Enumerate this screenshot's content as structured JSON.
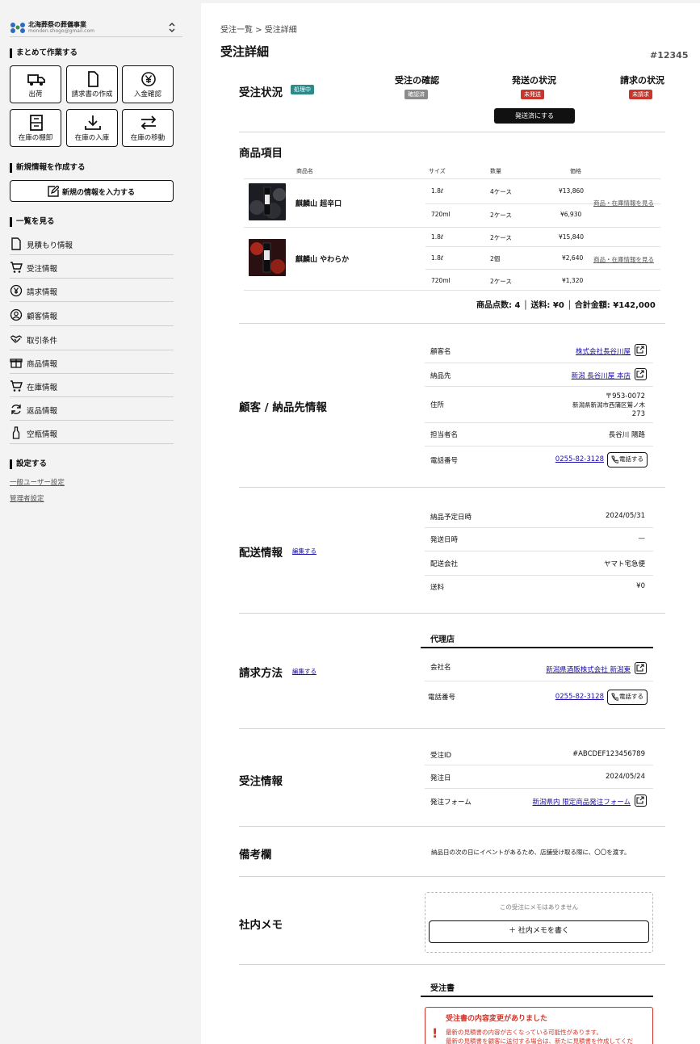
{
  "sidebar": {
    "company": "北海葬祭の葬儀事業",
    "email": "monden.shogo@gmail.com",
    "bulk_title": "まとめて作業する",
    "tiles": [
      "出荷",
      "請求書の作成",
      "入金確認",
      "在庫の棚卸",
      "在庫の入庫",
      "在庫の移動"
    ],
    "new_title": "新規情報を作成する",
    "new_button": "新規の情報を入力する",
    "list_title": "一覧を見る",
    "nav": [
      "見積もり情報",
      "受注情報",
      "請求情報",
      "顧客情報",
      "取引条件",
      "商品情報",
      "在庫情報",
      "返品情報",
      "空瓶情報"
    ],
    "settings_title": "設定する",
    "settings": [
      "一般ユーザー設定",
      "管理者設定"
    ]
  },
  "header": {
    "breadcrumb": "受注一覧 > 受注詳細",
    "title": "受注詳細",
    "order_no": "#12345"
  },
  "status": {
    "title": "受注状況",
    "badge": "処理中",
    "confirm_label": "受注の確認",
    "confirm_badge": "確認済",
    "ship_label": "発送の状況",
    "ship_badge": "未発送",
    "invoice_label": "請求の状況",
    "invoice_badge": "未請求",
    "ship_button": "発送済にする"
  },
  "products": {
    "title": "商品項目",
    "columns": [
      "商品名",
      "サイズ",
      "数量",
      "価格"
    ],
    "items": [
      {
        "name": "麒麟山 超辛口",
        "rows": [
          [
            "1.8ℓ",
            "4ケース",
            "¥13,860"
          ],
          [
            "720ml",
            "2ケース",
            "¥6,930"
          ]
        ],
        "link": "商品・在庫情報を見る"
      },
      {
        "name": "麒麟山 やわらか",
        "rows": [
          [
            "1.8ℓ",
            "2ケース",
            "¥15,840"
          ],
          [
            "1.8ℓ",
            "2個",
            "¥2,640"
          ],
          [
            "720ml",
            "2ケース",
            "¥1,320"
          ]
        ],
        "link": "商品・在庫情報を見る"
      }
    ],
    "totals": "商品点数: 4 │ 送料: ¥0 │ 合計金額: ¥142,000"
  },
  "customer": {
    "title": "顧客 / 納品先情報",
    "name_label": "顧客名",
    "name": "株式会社長谷川屋",
    "dest_label": "納品先",
    "dest": "新潟 長谷川屋 本店",
    "addr_label": "住所",
    "addr1": "〒953-0072",
    "addr2": "新潟県新潟市西蒲区鷲ノ木",
    "addr3": "273",
    "contact_label": "担当者名",
    "contact": "長谷川 陽路",
    "phone_label": "電話番号",
    "phone": "0255-82-3128",
    "call": "電話する"
  },
  "delivery": {
    "title": "配送情報",
    "edit": "編集する",
    "date_label": "納品予定日時",
    "date": "2024/05/31",
    "ship_label": "発送日時",
    "ship": "—",
    "carrier_label": "配送会社",
    "carrier": "ヤマト宅急便",
    "fee_label": "送料",
    "fee": "¥0"
  },
  "billing": {
    "title": "請求方法",
    "edit": "編集する",
    "sub": "代理店",
    "company_label": "会社名",
    "company": "新潟県酒販株式会社 新潟東",
    "phone_label": "電話番号",
    "phone": "0255-82-3128",
    "call": "電話する"
  },
  "order": {
    "title": "受注情報",
    "id_label": "受注ID",
    "id": "#ABCDEF123456789",
    "date_label": "発注日",
    "date": "2024/05/24",
    "form_label": "発注フォーム",
    "form": "新潟県内 限定商品発注フォーム"
  },
  "notes": {
    "title": "備考欄",
    "text": "納品日の次の日にイベントがあるため、店舗受け取る際に、〇〇を渡す。"
  },
  "memo": {
    "title": "社内メモ",
    "empty": "この受注にメモはありません",
    "button": "＋ 社内メモを書く"
  },
  "doc": {
    "sub": "受注書",
    "alert_title": "受注書の内容変更がありました",
    "alert_1": "最新の見積書の内容が古くなっている可能性があります。",
    "alert_2": "最新の見積書を顧客に送付する場合は、新たに見積書を作成してくだ"
  },
  "colors": {
    "badge_teal": "#2f8a87",
    "badge_gray": "#8a8a8a",
    "badge_red": "#c9352b",
    "link": "#1a0dab"
  }
}
